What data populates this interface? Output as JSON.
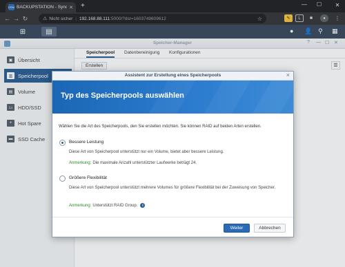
{
  "browser": {
    "tab_title": "BACKUPSTATION - Synology Disk",
    "tab_favicon": "DSM",
    "new_tab": "+",
    "address": {
      "security_label": "Nicht sicher",
      "host": "192.168.88.111",
      "path": ":5000/?dsr=1603749609612"
    }
  },
  "window": {
    "title": "Speicher-Manager"
  },
  "sidebar": {
    "items": [
      {
        "label": "Übersicht",
        "icon": "overview-icon"
      },
      {
        "label": "Speicherpool",
        "icon": "storage-pool-icon"
      },
      {
        "label": "Volume",
        "icon": "volume-icon"
      },
      {
        "label": "HDD/SSD",
        "icon": "disk-icon"
      },
      {
        "label": "Hot Spare",
        "icon": "hot-spare-icon"
      },
      {
        "label": "SSD Cache",
        "icon": "ssd-cache-icon"
      }
    ],
    "active_index": 1
  },
  "tabs": [
    {
      "label": "Speicherpool"
    },
    {
      "label": "Datenbereinigung"
    },
    {
      "label": "Konfigurationen"
    }
  ],
  "toolbar": {
    "create_label": "Erstellen"
  },
  "dialog": {
    "title": "Assistent zur Erstellung eines Speicherpools",
    "header": "Typ des Speicherpools auswählen",
    "intro": "Wählen Sie die Art des Speicherpools, den Sie erstellen möchten. Sie können RAID auf beiden Arten erstellen.",
    "options": [
      {
        "label": "Bessere Leistung",
        "selected": true,
        "description": "Diese Art von Speicherpool unterstützt nur ein Volume, bietet aber bessere Leistung.",
        "note_key": "Anmerkung:",
        "note_text": "Die maximale Anzahl unterstützter Laufwerke beträgt 24."
      },
      {
        "label": "Größere Flexibilität",
        "selected": false,
        "description": "Diese Art von Speicherpool unterstützt mehrere Volumes für größere Flexibilität bei der Zuweisung von Speicher.",
        "note_key": "Anmerkung:",
        "note_text": "Unterstützt RAID Group."
      }
    ],
    "buttons": {
      "next": "Weiter",
      "cancel": "Abbrechen"
    }
  },
  "colors": {
    "accent": "#2b5e95",
    "header_blue": "#1b67b5",
    "note_green": "#2a8a2a"
  }
}
